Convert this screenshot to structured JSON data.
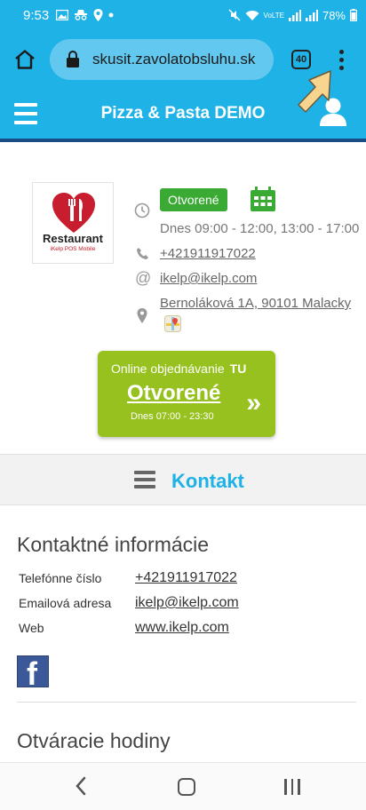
{
  "status_bar": {
    "time": "9:53",
    "battery": "78%",
    "network": "VoLTE"
  },
  "browser": {
    "url": "skusit.zavolatobsluhu.sk",
    "tab_count": "40"
  },
  "site": {
    "title": "Pizza & Pasta DEMO"
  },
  "restaurant": {
    "logo_name": "Restaurant",
    "logo_sub": "iKelp POS Mobile",
    "status": "Otvorené",
    "hours": "Dnes 09:00 - 12:00, 13:00 - 17:00",
    "phone": "+421911917022",
    "email": "ikelp@ikelp.com",
    "address": "Bernoláková 1A, 90101 Malacky"
  },
  "online_order": {
    "label": "Online objednávanie",
    "here": "TU",
    "status": "Otvorené",
    "hours": "Dnes 07:00 - 23:30",
    "chevron": "»"
  },
  "section": {
    "title": "Kontakt"
  },
  "contact": {
    "heading": "Kontaktné informácie",
    "rows": [
      {
        "label": "Telefónne číslo",
        "value": "+421911917022"
      },
      {
        "label": "Emailová adresa",
        "value": "ikelp@ikelp.com"
      },
      {
        "label": "Web",
        "value": "www.ikelp.com"
      }
    ],
    "facebook_letter": "f"
  },
  "opening_hours": {
    "heading": "Otváracie hodiny"
  },
  "colors": {
    "brand": "#1fb2e6",
    "open_green": "#3aaa35",
    "order_green": "#96c11f",
    "header_line": "#1a4d86"
  }
}
